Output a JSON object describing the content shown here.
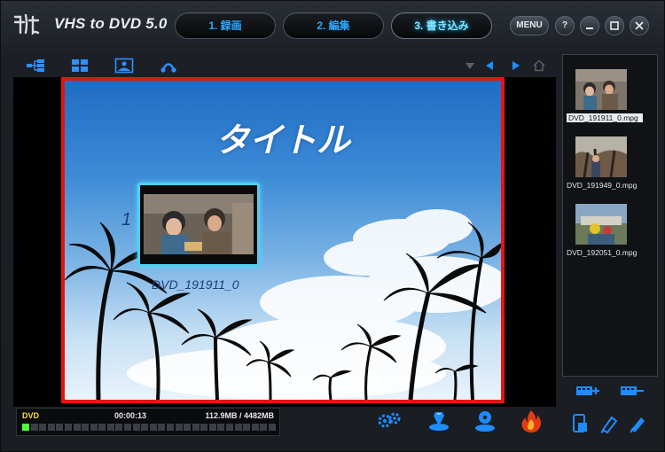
{
  "app": {
    "title": "VHS to DVD 5.0",
    "accent_color": "#2aa7ff",
    "frame_highlight_color": "#e5150f"
  },
  "steps": [
    {
      "label": "1. 録画",
      "active": false
    },
    {
      "label": "2. 編集",
      "active": false
    },
    {
      "label": "3. 書き込み",
      "active": true
    }
  ],
  "window_controls": {
    "menu_label": "MENU",
    "help_label": "?",
    "minimize_label": "—",
    "maximize_label": "□",
    "close_label": "✕"
  },
  "toolbar": {
    "tools": [
      "menu-structure-icon",
      "layout-grid-icon",
      "background-image-icon",
      "music-note-icon"
    ],
    "nav": [
      "dropdown-arrow-icon",
      "prev-arrow-icon",
      "next-arrow-icon",
      "home-icon"
    ]
  },
  "menu_preview": {
    "title": "タイトル",
    "chapter_number": "1",
    "chapter_label": "DVD_191911_0"
  },
  "status": {
    "disc_type": "DVD",
    "duration": "00:00:13",
    "size": "112.9MB / 4482MB",
    "capacity_used_fraction": 0.025
  },
  "bottom_actions": [
    "settings-gears-icon",
    "disc-edit-icon",
    "disc-burn-icon",
    "fire-burn-icon"
  ],
  "clips": [
    {
      "name": "DVD_191911_0.mpg",
      "selected": true
    },
    {
      "name": "DVD_191949_0.mpg",
      "selected": false
    },
    {
      "name": "DVD_192051_0.mpg",
      "selected": false
    }
  ],
  "sidebar_buttons": [
    "add-clip-icon",
    "remove-clip-icon"
  ],
  "sidebar_bottom": [
    "device-icon",
    "usb-icon",
    "edit-pen-icon"
  ]
}
